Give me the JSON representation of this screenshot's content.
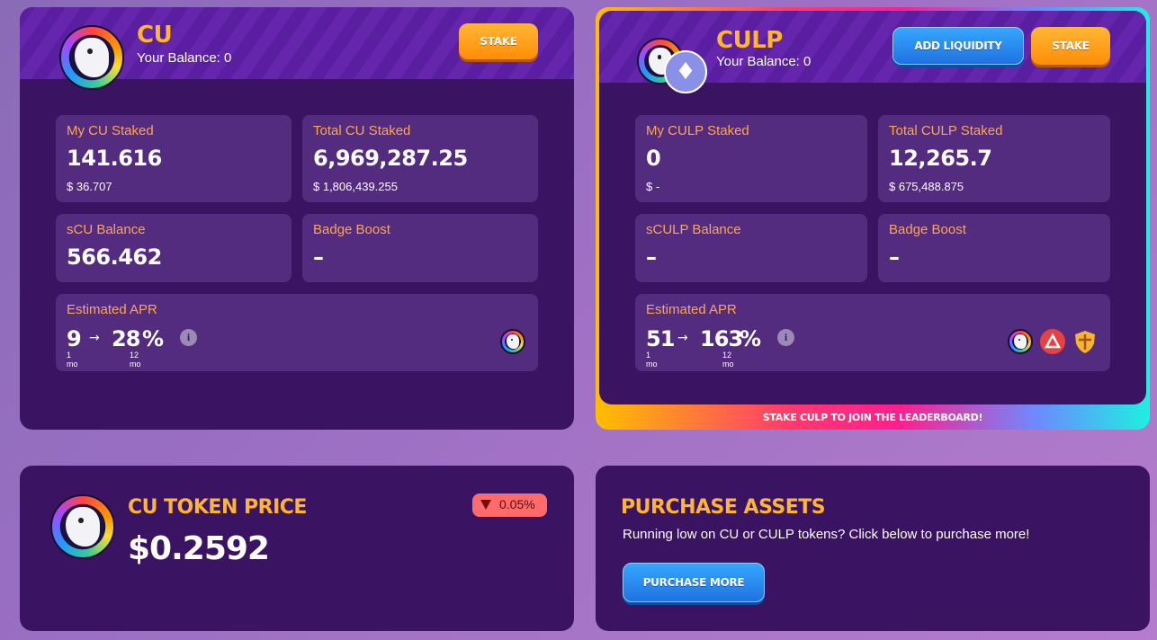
{
  "cu_panel": {
    "title": "CU",
    "balance": "Your Balance: 0",
    "stake_label": "STAKE",
    "my_staked": {
      "label": "My CU Staked",
      "value": "141.616",
      "usd": "$ 36.707"
    },
    "total_staked": {
      "label": "Total CU Staked",
      "value": "6,969,287.25",
      "usd": "$ 1,806,439.255"
    },
    "s_balance": {
      "label": "sCU Balance",
      "value": "566.462"
    },
    "badge_boost": {
      "label": "Badge Boost",
      "value": "–"
    },
    "apr": {
      "label": "Estimated APR",
      "from": "9",
      "to": "28",
      "pct": "%",
      "from_period": "1 mo",
      "to_period": "12 mo",
      "arrow": "→"
    }
  },
  "culp_panel": {
    "title": "CULP",
    "balance": "Your Balance: 0",
    "add_liquidity_label": "ADD LIQUIDITY",
    "stake_label": "STAKE",
    "my_staked": {
      "label": "My CULP Staked",
      "value": "0",
      "usd": "$ -"
    },
    "total_staked": {
      "label": "Total CULP Staked",
      "value": "12,265.7",
      "usd": "$ 675,488.875"
    },
    "s_balance": {
      "label": "sCULP Balance",
      "value": "–"
    },
    "badge_boost": {
      "label": "Badge Boost",
      "value": "–"
    },
    "apr": {
      "label": "Estimated APR",
      "from": "51",
      "to": "163",
      "pct": "%",
      "from_period": "1 mo",
      "to_period": "12 mo",
      "arrow": "→"
    },
    "leaderboard_banner": "STAKE CULP TO JOIN THE LEADERBOARD!"
  },
  "price_panel": {
    "title": "CU TOKEN PRICE",
    "price": "$0.2592",
    "change": "0.05%",
    "change_direction": "down",
    "down_color": "#ff6b6b"
  },
  "purchase_panel": {
    "title": "PURCHASE ASSETS",
    "description": "Running low on CU or CULP tokens? Click below to purchase more!",
    "button_label": "PURCHASE MORE"
  },
  "colors": {
    "accent_orange": "#ffb52e",
    "panel_bg": "#3a1463",
    "card_bg": "#532c7f",
    "label_orange": "#ffa552"
  }
}
